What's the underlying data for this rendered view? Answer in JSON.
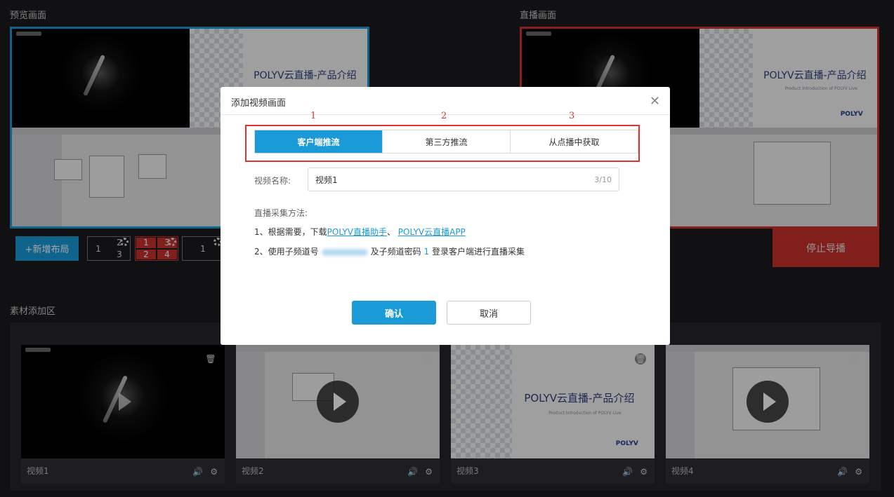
{
  "preview": {
    "title": "预览画面"
  },
  "live": {
    "title": "直播画面"
  },
  "slide": {
    "title": "POLYV云直播-产品介绍",
    "subtitle": "Product Introduction of POLYV Live",
    "logo": "POLYV"
  },
  "layout": {
    "add_label": "+新增布局",
    "box1": [
      "1",
      "2",
      "3"
    ],
    "box2": [
      "1",
      "3",
      "2",
      "4"
    ],
    "box3": [
      "1"
    ]
  },
  "stop_label": "停止导播",
  "material": {
    "title": "素材添加区",
    "items": [
      {
        "label": "视频1"
      },
      {
        "label": "视频2"
      },
      {
        "label": "视频3"
      },
      {
        "label": "视频4"
      }
    ]
  },
  "modal": {
    "title": "添加视频画面",
    "tab_numbers": [
      "1",
      "2",
      "3"
    ],
    "tabs": [
      "客户端推流",
      "第三方推流",
      "从点播中获取"
    ],
    "name_label": "视频名称:",
    "name_value": "视频1",
    "name_count": "3/10",
    "method_title": "直播采集方法:",
    "step1_prefix": "1、根据需要，下载",
    "step1_link1": "POLYV直播助手",
    "step1_sep": "、 ",
    "step1_link2": "POLYV云直播APP",
    "step2_prefix": "2、使用子频道号",
    "step2_mid": "及子频道密码",
    "step2_pwd": "1",
    "step2_suffix": "登录客户端进行直播采集",
    "confirm": "确认",
    "cancel": "取消"
  }
}
